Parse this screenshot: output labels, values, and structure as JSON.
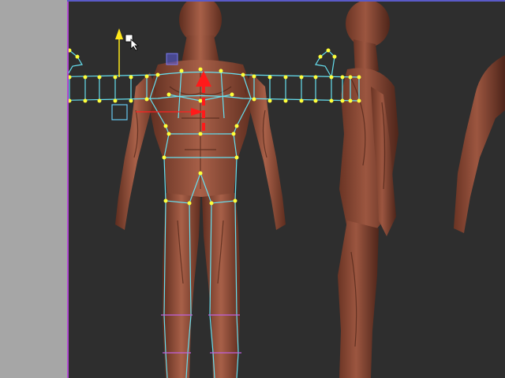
{
  "colors": {
    "panel": "#a6a6a6",
    "viewport_bg": "#2e2e2e",
    "viewport_edge": "#b04bd0",
    "skin": "#8a4a35",
    "skin_dark": "#5e2d1f",
    "skin_light": "#a86048",
    "rig_line": "#66e0f0",
    "rig_point": "#ffff3a",
    "gizmo_y": "#ffe81a",
    "gizmo_move": "#ff1a1a",
    "selection": "#5a5ad0"
  },
  "icons": {
    "cursor": "arrow-cursor-icon",
    "move_gizmo": "transform-gizmo-icon"
  }
}
